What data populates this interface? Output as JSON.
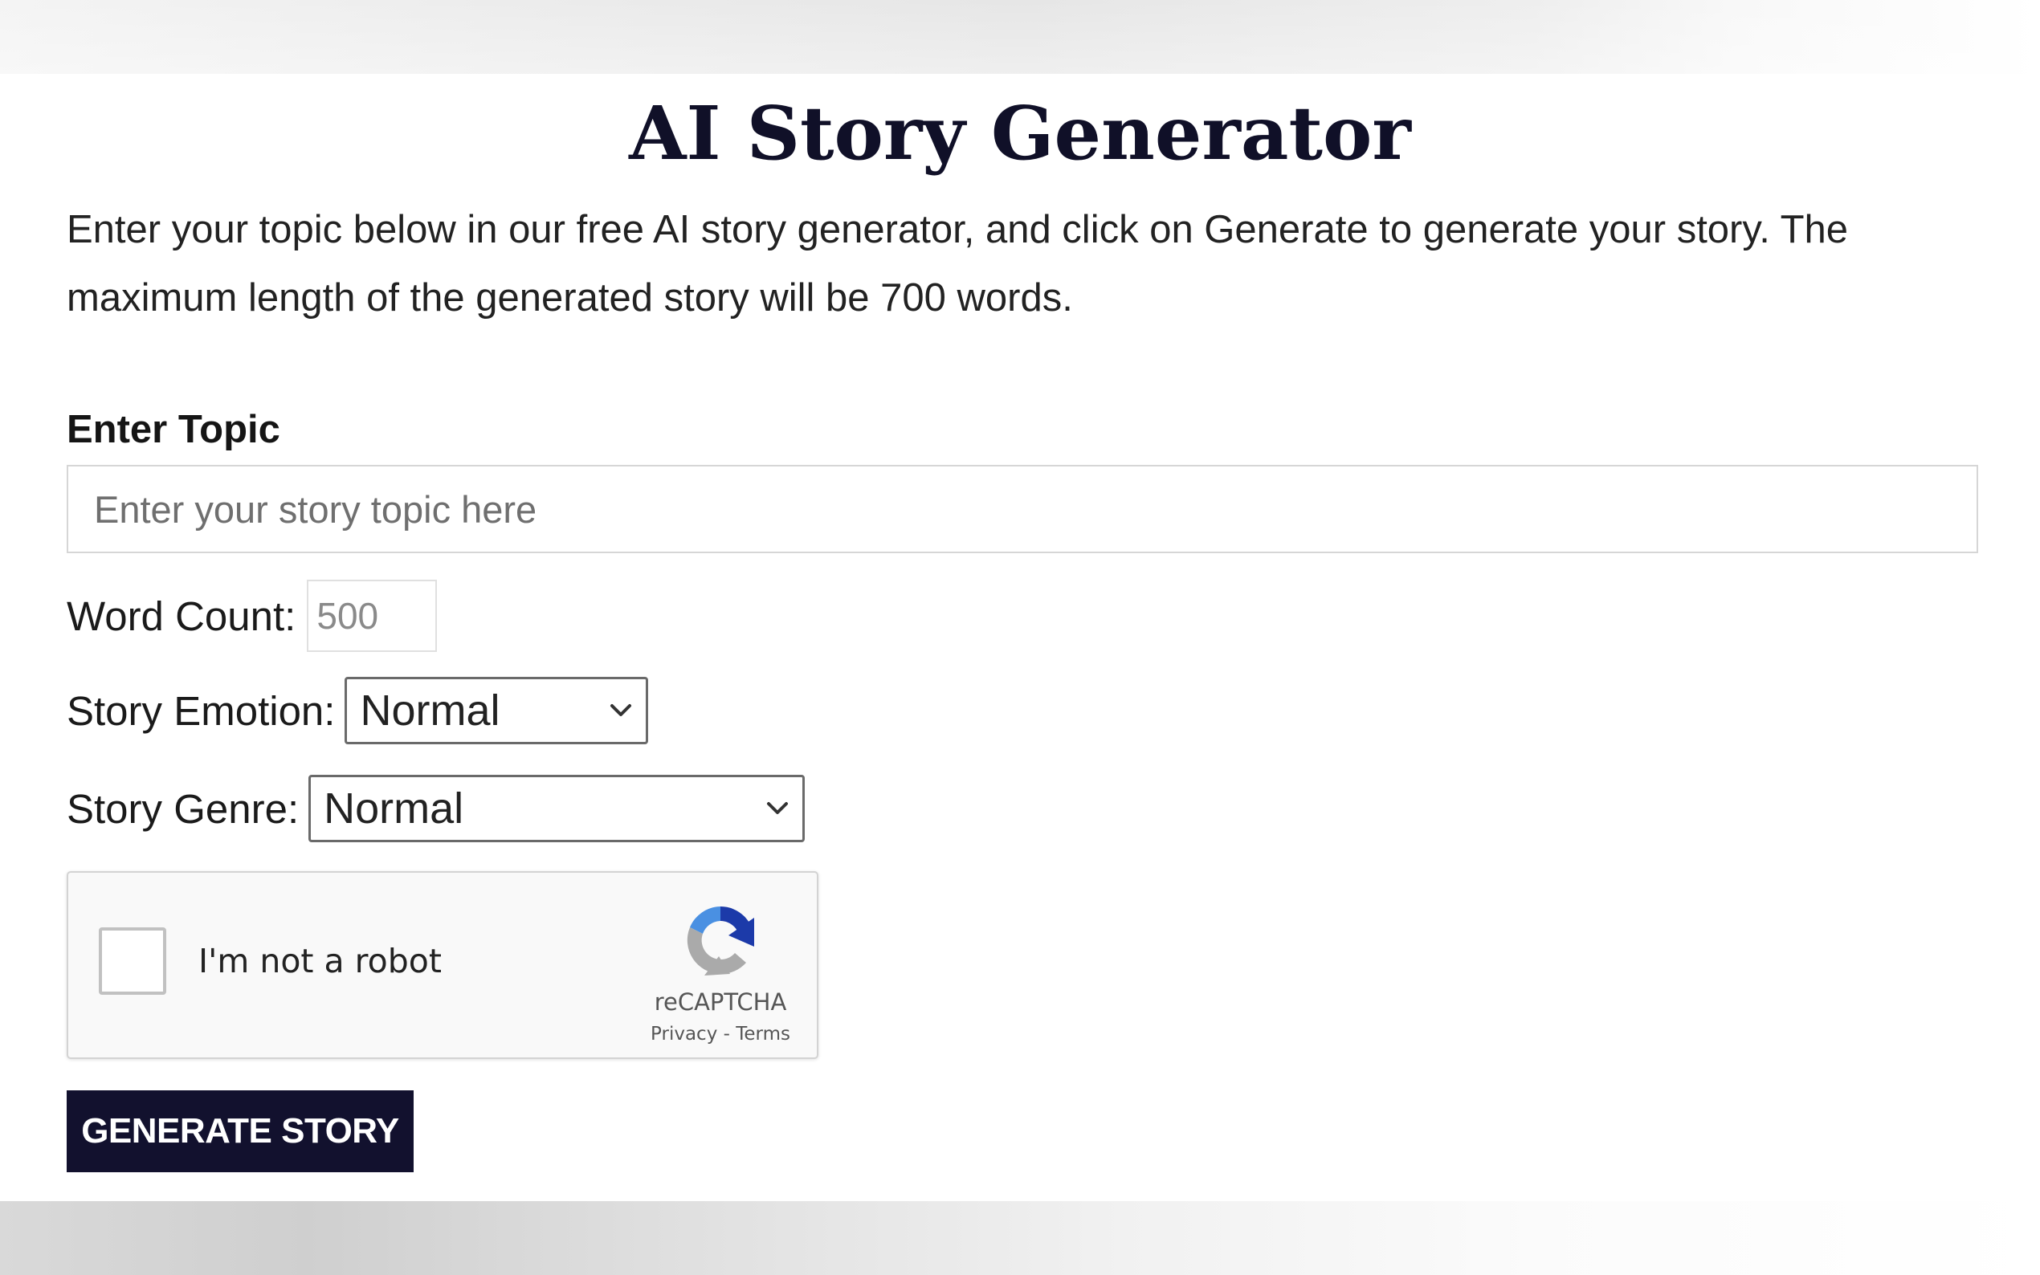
{
  "page": {
    "title": "AI Story Generator",
    "intro": "Enter your topic below in our free AI story generator, and click on Generate to generate your story. The maximum length of the generated story will be 700 words."
  },
  "form": {
    "topic_label": "Enter Topic",
    "topic_placeholder": "Enter your story topic here",
    "word_count_label": "Word Count:",
    "word_count_placeholder": "500",
    "emotion_label": "Story Emotion:",
    "emotion_selected": "Normal",
    "genre_label": "Story Genre:",
    "genre_selected": "Normal",
    "submit_label": "GENERATE STORY"
  },
  "captcha": {
    "checkbox_label": "I'm not a robot",
    "brand": "reCAPTCHA",
    "privacy_link": "Privacy",
    "separator": " - ",
    "terms_link": "Terms",
    "logo_icon": "recaptcha-logo-icon"
  },
  "colors": {
    "title": "#101028",
    "button_bg": "#12112e",
    "button_text": "#ffffff",
    "recaptcha_blue": "#1c3aa9",
    "recaptcha_lightblue": "#4a90e2",
    "recaptcha_gray": "#aaaaaa"
  }
}
